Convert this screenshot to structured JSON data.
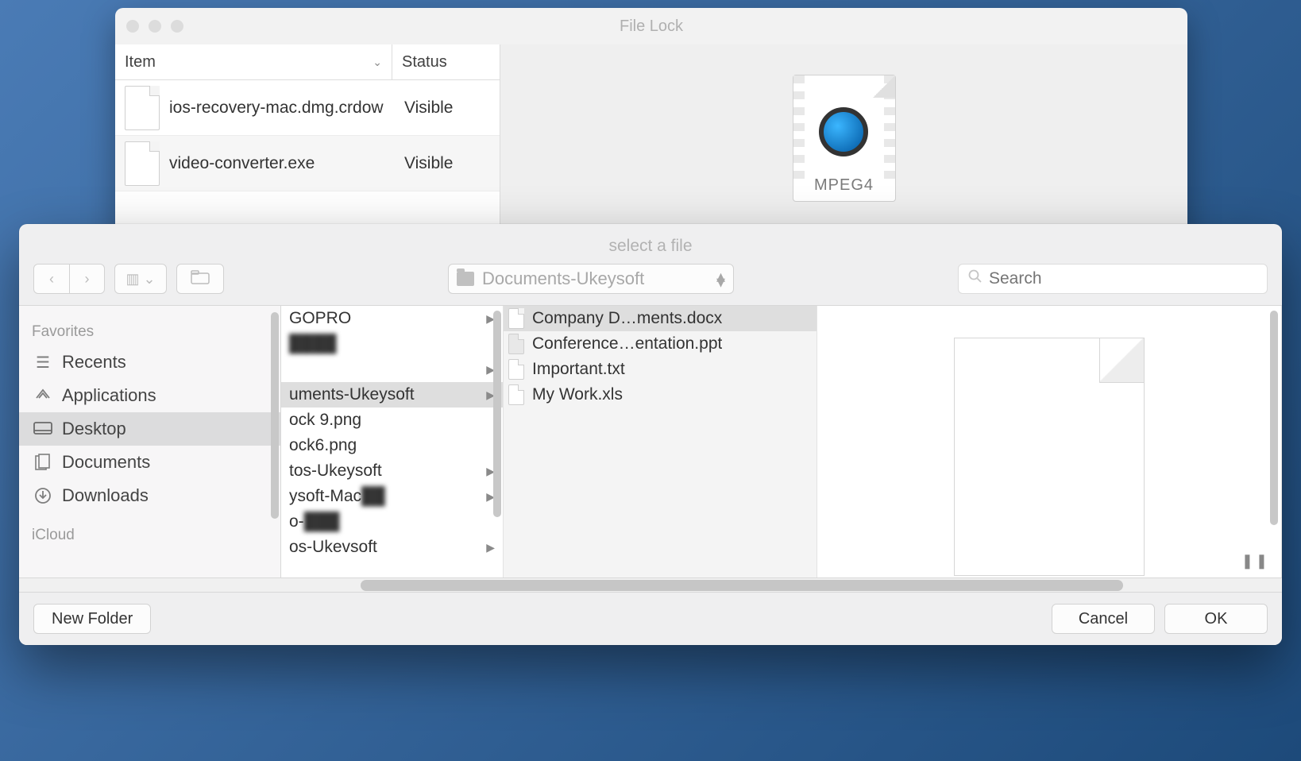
{
  "back_window": {
    "title": "File Lock",
    "columns": {
      "item": "Item",
      "status": "Status"
    },
    "rows": [
      {
        "name": "ios-recovery-mac.dmg.crdow",
        "status": "Visible"
      },
      {
        "name": "video-converter.exe",
        "status": "Visible"
      }
    ],
    "preview_label": "MPEG4"
  },
  "dialog": {
    "title": "select a file",
    "path_dropdown": "Documents-Ukeysoft",
    "search_placeholder": "Search",
    "sidebar": {
      "sections": [
        {
          "heading": "Favorites",
          "items": [
            {
              "label": "Recents"
            },
            {
              "label": "Applications"
            },
            {
              "label": "Desktop",
              "selected": true
            },
            {
              "label": "Documents"
            },
            {
              "label": "Downloads"
            }
          ]
        },
        {
          "heading": "iCloud",
          "items": []
        }
      ]
    },
    "column1": [
      {
        "name": "GOPRO",
        "arrow": true
      },
      {
        "name": "",
        "arrow": false,
        "blur": true
      },
      {
        "name": "",
        "arrow": true
      },
      {
        "name": "uments-Ukeysoft",
        "arrow": true,
        "selected": true
      },
      {
        "name": "ock 9.png",
        "arrow": false
      },
      {
        "name": "ock6.png",
        "arrow": false
      },
      {
        "name": "tos-Ukeysoft",
        "arrow": true
      },
      {
        "name": "ysoft-Mac",
        "arrow": true,
        "blur_suffix": true
      },
      {
        "name": "o-",
        "arrow": false,
        "blur_suffix": true
      },
      {
        "name": "os-Ukevsoft",
        "arrow": true
      }
    ],
    "column2": [
      {
        "name": "Company D…ments.docx",
        "selected": true
      },
      {
        "name": "Conference…entation.ppt"
      },
      {
        "name": "Important.txt"
      },
      {
        "name": "My Work.xls"
      }
    ],
    "footer": {
      "new_folder": "New Folder",
      "cancel": "Cancel",
      "ok": "OK"
    }
  }
}
